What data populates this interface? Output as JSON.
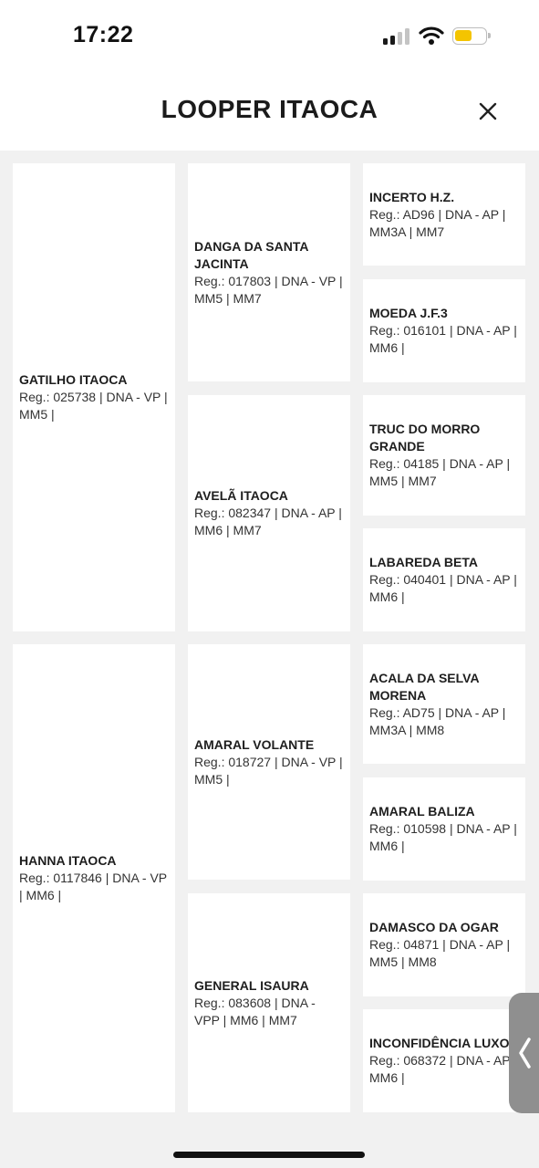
{
  "status_bar": {
    "time": "17:22"
  },
  "header": {
    "title": "LOOPER ITAOCA"
  },
  "pedigree": {
    "sire": {
      "name": "GATILHO ITAOCA",
      "info": "Reg.: 025738 | DNA - VP | MM5 |"
    },
    "dam": {
      "name": "HANNA ITAOCA",
      "info": "Reg.: 0117846 | DNA - VP | MM6 |"
    },
    "sire_sire": {
      "name": "DANGA DA SANTA JACINTA",
      "info": "Reg.: 017803 | DNA - VP | MM5 | MM7"
    },
    "sire_dam": {
      "name": "AVELÃ ITAOCA",
      "info": "Reg.: 082347 | DNA - AP | MM6 | MM7"
    },
    "dam_sire": {
      "name": "AMARAL VOLANTE",
      "info": "Reg.: 018727 | DNA - VP | MM5 |"
    },
    "dam_dam": {
      "name": "GENERAL ISAURA",
      "info": "Reg.: 083608 | DNA - VPP | MM6 | MM7"
    },
    "ggp": [
      {
        "name": "INCERTO H.Z.",
        "info": "Reg.: AD96 | DNA - AP | MM3A | MM7"
      },
      {
        "name": "MOEDA J.F.3",
        "info": "Reg.: 016101 | DNA - AP | MM6 |"
      },
      {
        "name": "TRUC DO MORRO GRANDE",
        "info": "Reg.: 04185 | DNA - AP | MM5 | MM7"
      },
      {
        "name": "LABAREDA BETA",
        "info": "Reg.: 040401 | DNA - AP | MM6 |"
      },
      {
        "name": "ACALA DA SELVA MORENA",
        "info": "Reg.: AD75 | DNA - AP | MM3A | MM8"
      },
      {
        "name": "AMARAL BALIZA",
        "info": "Reg.: 010598 | DNA - AP | MM6 |"
      },
      {
        "name": "DAMASCO DA OGAR",
        "info": "Reg.: 04871 | DNA - AP | MM5 | MM8"
      },
      {
        "name": "INCONFIDÊNCIA LUXO",
        "info": "Reg.: 068372 | DNA - AP | MM6 |"
      }
    ]
  },
  "icons": {
    "close": "close-icon",
    "side_tab": "chevron-left-icon",
    "signal": "cellular-signal-icon",
    "wifi": "wifi-icon",
    "battery": "battery-icon"
  },
  "colors": {
    "battery_fill": "#f4c400",
    "background": "#f1f1f1",
    "card": "#ffffff"
  }
}
